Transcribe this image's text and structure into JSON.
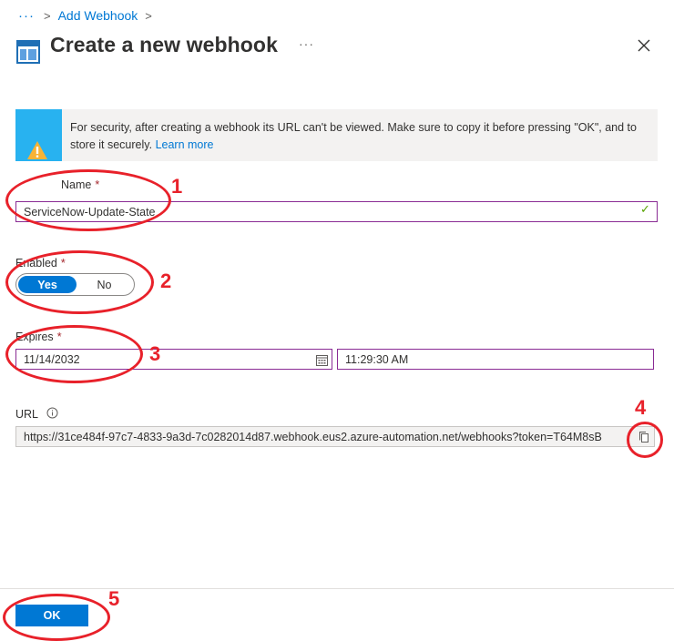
{
  "breadcrumb": {
    "more": "···",
    "items": [
      {
        "label": "Add Webhook"
      }
    ]
  },
  "header": {
    "title": "Create a new webhook",
    "more": "···"
  },
  "banner": {
    "text": "For security, after creating a webhook its URL can't be viewed. Make sure to copy it before pressing \"OK\", and to store it securely.",
    "link": "Learn more"
  },
  "form": {
    "name": {
      "label": "Name",
      "required": "*",
      "value": "ServiceNow-Update-State"
    },
    "enabled": {
      "label": "Enabled",
      "required": "*",
      "yes": "Yes",
      "no": "No",
      "selected": "Yes"
    },
    "expires": {
      "label": "Expires",
      "required": "*",
      "date": "11/14/2032",
      "time": "11:29:30 AM"
    },
    "url": {
      "label": "URL",
      "value": "https://31ce484f-97c7-4833-9a3d-7c0282014d87.webhook.eus2.azure-automation.net/webhooks?token=T64M8sB"
    }
  },
  "footer": {
    "ok_label": "OK"
  },
  "annotations": [
    "1",
    "2",
    "3",
    "4",
    "5"
  ],
  "colors": {
    "accent": "#0078d4",
    "banner_strip": "#28b2f0",
    "warning": "#f7b336",
    "annotation": "#e8212a",
    "focus_border": "#8a2b94"
  }
}
